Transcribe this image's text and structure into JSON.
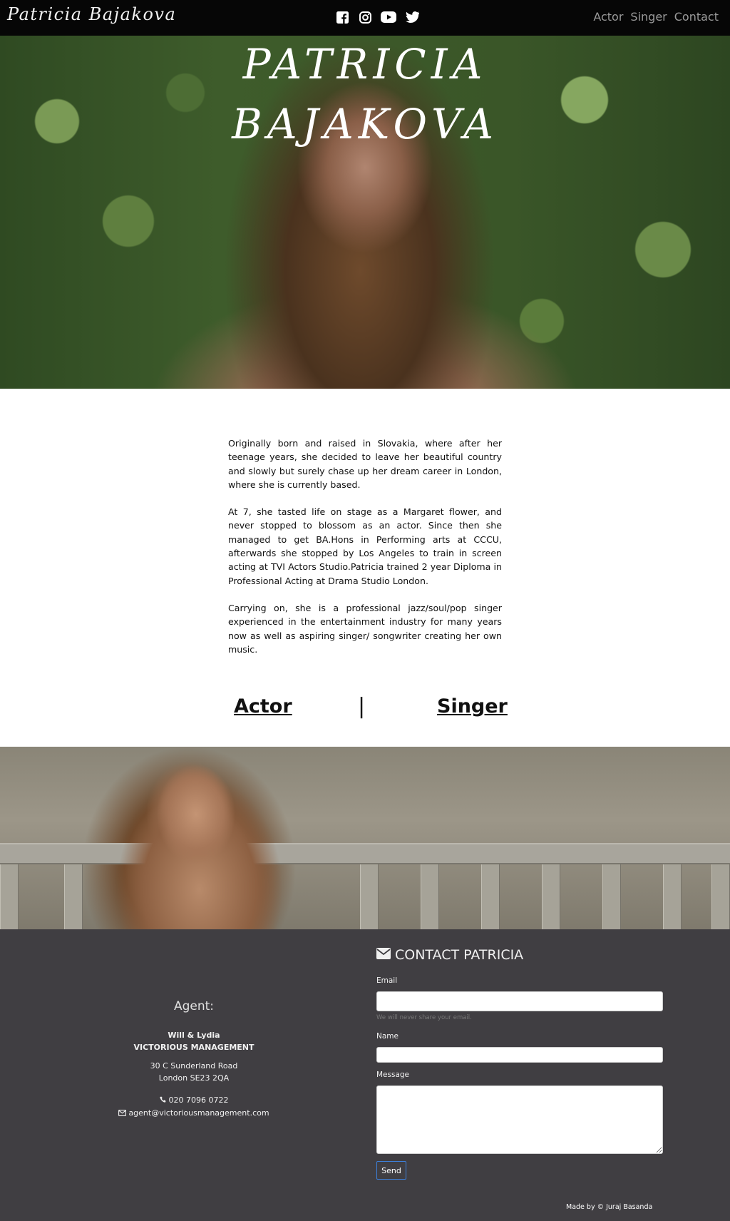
{
  "navbar": {
    "brand": "Patricia Bajakova",
    "social_icons": [
      "facebook-icon",
      "instagram-icon",
      "youtube-icon",
      "twitter-icon"
    ],
    "links": [
      "Actor",
      "Singer",
      "Contact"
    ]
  },
  "hero": {
    "title_line1": "PATRICIA",
    "title_line2": "BAJAKOVA"
  },
  "bio": {
    "paragraphs": [
      "Originally born and raised in Slovakia, where after her teenage years, she decided to leave her beautiful country and slowly but surely chase up her dream career in London, where she is currently based.",
      "At 7, she tasted life on stage as a Margaret flower, and never stopped to blossom as an actor. Since then she managed to get BA.Hons in Performing arts at CCCU, afterwards she stopped by Los Angeles to train in screen acting at TVI Actors Studio.Patricia trained 2 year Diploma in Professional Acting at Drama Studio London.",
      "Carrying on, she is a professional jazz/soul/pop singer experienced in the entertainment industry for many years now as well as aspiring singer/ songwriter creating her own music."
    ]
  },
  "roles": {
    "actor": "Actor",
    "separator": "|",
    "singer": "Singer"
  },
  "agent": {
    "title": "Agent:",
    "names": "Will & Lydia",
    "company": "VICTORIOUS MANAGEMENT",
    "address_line1": "30 C Sunderland Road",
    "address_line2": "London SE23 2QA",
    "phone": "020 7096 0722",
    "email": "agent@victoriousmanagement.com"
  },
  "contact_form": {
    "heading": "CONTACT PATRICIA",
    "email_label": "Email",
    "email_value": "",
    "email_help": "We will never share your email.",
    "name_label": "Name",
    "name_value": "",
    "message_label": "Message",
    "message_value": "",
    "send_label": "Send"
  },
  "footer": {
    "credit": "Made by © Juraj Basanda"
  },
  "colors": {
    "navbar_bg": "#060606",
    "footer_bg": "#403e42",
    "send_border": "#3d7fd9"
  }
}
